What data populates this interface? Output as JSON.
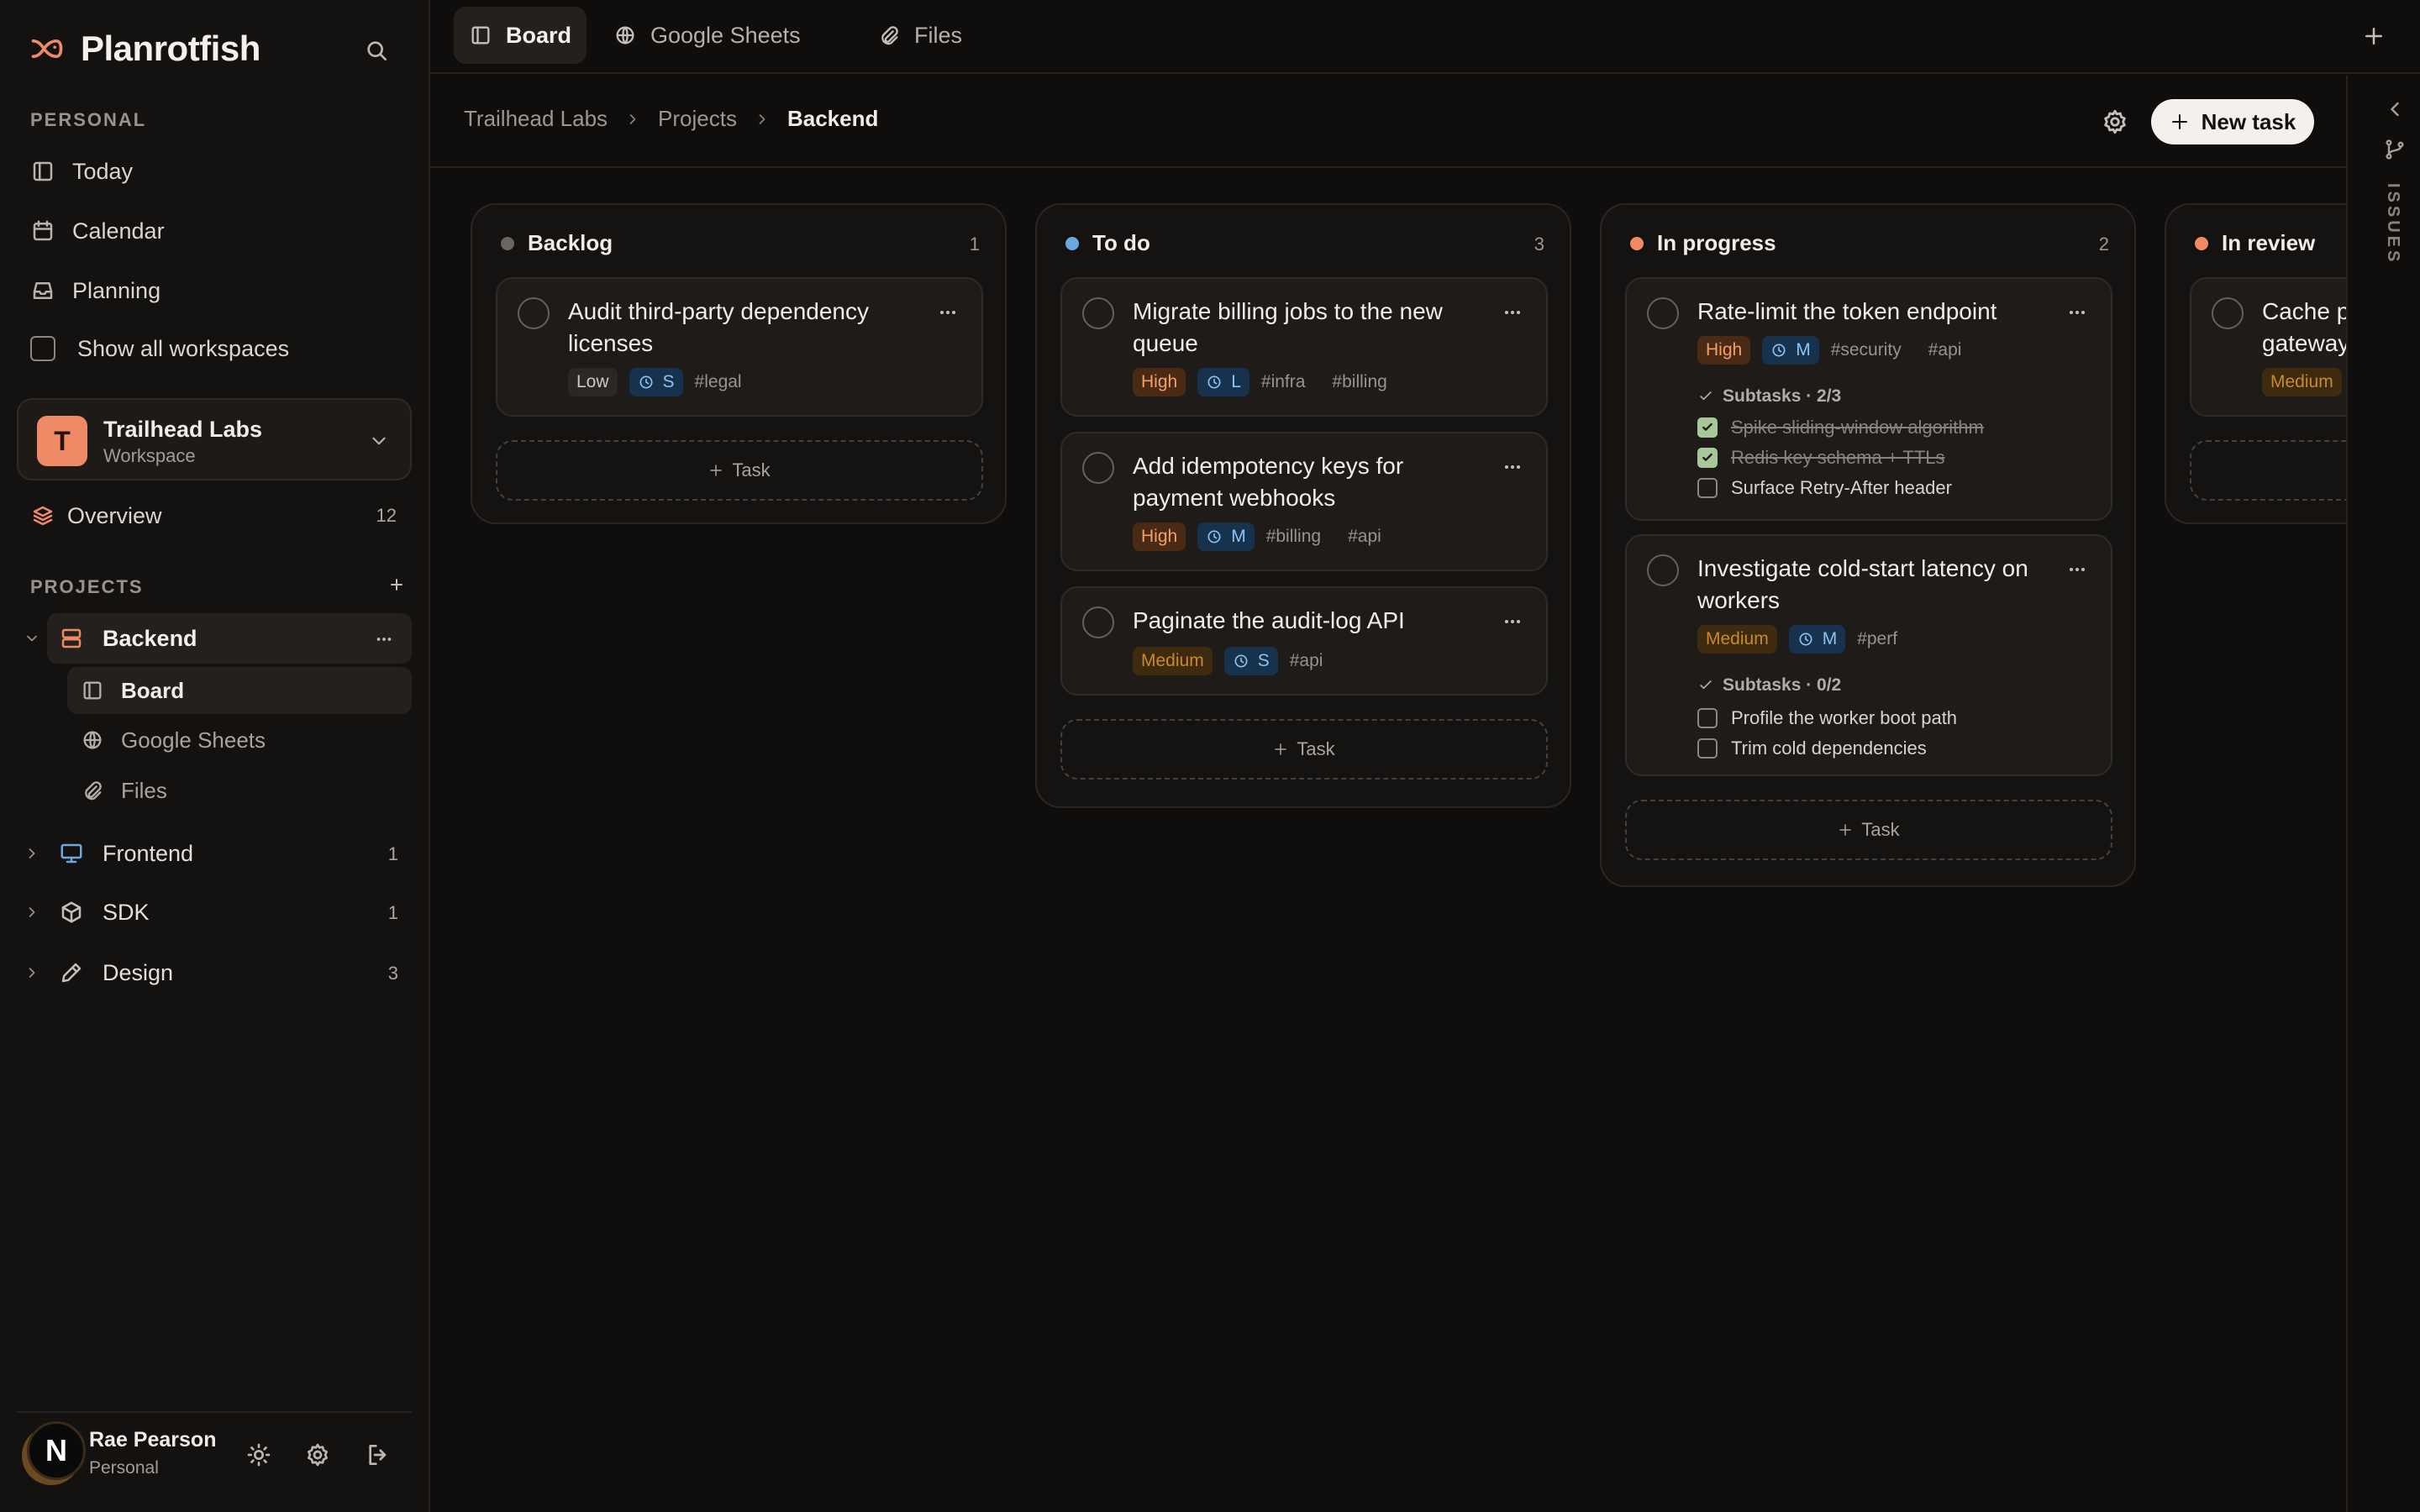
{
  "app": {
    "title": "Planrotfish"
  },
  "sidebar": {
    "personal_label": "PERSONAL",
    "nav": [
      {
        "label": "Today",
        "icon": "layout-icon"
      },
      {
        "label": "Calendar",
        "icon": "calendar-icon"
      },
      {
        "label": "Planning",
        "icon": "inbox-icon"
      }
    ],
    "show_all_workspaces": "Show all workspaces",
    "workspace": {
      "avatar": "T",
      "name": "Trailhead Labs",
      "type": "Workspace"
    },
    "overview": {
      "label": "Overview",
      "count": "12"
    },
    "projects_label": "PROJECTS",
    "projects": [
      {
        "label": "Backend",
        "color": "#ef8a67",
        "expanded": true,
        "children": [
          {
            "label": "Board"
          },
          {
            "label": "Google Sheets"
          },
          {
            "label": "Files"
          }
        ]
      },
      {
        "label": "Frontend",
        "count": "1",
        "color": "#6aa8e0"
      },
      {
        "label": "SDK",
        "count": "1",
        "color": "#c6bfb9"
      },
      {
        "label": "Design",
        "count": "3",
        "color": "#c6bfb9"
      }
    ],
    "user": {
      "avatar": "N",
      "name": "Rae Pearson",
      "sub": "Personal"
    }
  },
  "tabs": [
    {
      "label": "Board",
      "active": true
    },
    {
      "label": "Google Sheets"
    },
    {
      "label": "Files"
    }
  ],
  "breadcrumb": [
    "Trailhead Labs",
    "Projects",
    "Backend"
  ],
  "header": {
    "new_task_label": "New task"
  },
  "rail": {
    "label": "ISSUES"
  },
  "add_task_label": "Task",
  "columns": [
    {
      "title": "Backlog",
      "count": "1",
      "color": "#6b6560",
      "cards": [
        {
          "title": "Audit third-party dependency licenses",
          "priority": "Low",
          "size": "S",
          "tags": [
            "#legal"
          ]
        }
      ]
    },
    {
      "title": "To do",
      "count": "3",
      "color": "#6aa8e0",
      "cards": [
        {
          "title": "Migrate billing jobs to the new queue",
          "priority": "High",
          "size": "L",
          "tags": [
            "#infra",
            "#billing"
          ]
        },
        {
          "title": "Add idempotency keys for payment webhooks",
          "priority": "High",
          "size": "M",
          "tags": [
            "#billing",
            "#api"
          ]
        },
        {
          "title": "Paginate the audit-log API",
          "priority": "Medium",
          "size": "S",
          "tags": [
            "#api"
          ]
        }
      ]
    },
    {
      "title": "In progress",
      "count": "2",
      "color": "#ef8a67",
      "cards": [
        {
          "title": "Rate-limit the token endpoint",
          "priority": "High",
          "size": "M",
          "tags": [
            "#security",
            "#api"
          ],
          "subtasks_label": "Subtasks · 2/3",
          "subtasks": [
            {
              "label": "Spike sliding-window algorithm",
              "done": true
            },
            {
              "label": "Redis key schema + TTLs",
              "done": true
            },
            {
              "label": "Surface Retry-After header",
              "done": false
            }
          ]
        },
        {
          "title": "Investigate cold-start latency on workers",
          "priority": "Medium",
          "size": "M",
          "tags": [
            "#perf"
          ],
          "subtasks_label": "Subtasks · 0/2",
          "subtasks": [
            {
              "label": "Profile the worker boot path",
              "done": false
            },
            {
              "label": "Trim cold dependencies",
              "done": false
            }
          ]
        }
      ]
    },
    {
      "title": "In review",
      "count": "",
      "color": "#ef8a67",
      "cards": [
        {
          "title": "Cache p gateway",
          "priority": "Medium",
          "size": "",
          "tags": []
        }
      ]
    }
  ]
}
